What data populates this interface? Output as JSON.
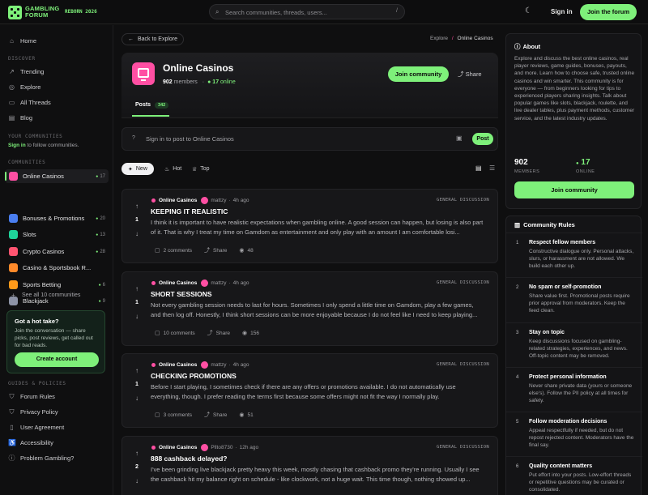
{
  "colors": {
    "accent": "#7ef07a",
    "pink": "#ff4fa3",
    "bg": "#0f0f10"
  },
  "topbar": {
    "logo_line1": "GAMBLING",
    "logo_line2": "FORUM",
    "logo_tag": "REBORN 2026",
    "search_placeholder": "Search communities, threads, users...",
    "search_shortcut": "/",
    "theme_icon": "moon-icon",
    "signin": "Sign in",
    "join": "Join the forum"
  },
  "sidebar": {
    "main": [
      {
        "label": "Home",
        "icon": "home-icon"
      }
    ],
    "discover_label": "DISCOVER",
    "discover": [
      {
        "label": "Trending",
        "icon": "trending-icon"
      },
      {
        "label": "Explore",
        "icon": "compass-icon"
      },
      {
        "label": "All Threads",
        "icon": "threads-icon"
      },
      {
        "label": "Blog",
        "icon": "book-icon"
      }
    ],
    "your_label": "YOUR COMMUNITIES",
    "your_signin": "Sign in",
    "your_text": " to follow communities.",
    "communities_label": "COMMUNITIES",
    "communities": [
      {
        "label": "Online Casinos",
        "count": "17",
        "color": "#ff4fa3"
      },
      {
        "label": "Bonuses & Promotions",
        "count": "20",
        "color": "#4a7ef0"
      },
      {
        "label": "Slots",
        "count": "13",
        "color": "#1fd39a"
      },
      {
        "label": "Crypto Casinos",
        "count": "28",
        "color": "#ff5470"
      },
      {
        "label": "Casino & Sportsbook R...",
        "count": "",
        "color": "#ff8a2a"
      },
      {
        "label": "Sports Betting",
        "count": "6",
        "color": "#ff9a1a"
      },
      {
        "label": "Blackjack",
        "count": "9",
        "color": "#8d93a6"
      }
    ],
    "see_all": "See all 10 communities",
    "hot_title": "Got a hot take?",
    "hot_text": "Join the conversation — share picks, post reviews, get called out for bad reads.",
    "hot_button": "Create account",
    "guides_label": "GUIDES & POLICIES",
    "guides": [
      {
        "label": "Forum Rules",
        "icon": "shield-icon"
      },
      {
        "label": "Privacy Policy",
        "icon": "shield-icon"
      },
      {
        "label": "User Agreement",
        "icon": "document-icon"
      },
      {
        "label": "Accessibility",
        "icon": "accessibility-icon"
      },
      {
        "label": "Problem Gambling?",
        "icon": "help-icon"
      }
    ]
  },
  "main": {
    "back": "Back to Explore",
    "breadcrumb": {
      "root": "Explore",
      "sep": "/",
      "current": "Online Casinos"
    },
    "community": {
      "name": "Online Casinos",
      "members_num": "902",
      "members_label": " members",
      "online_num": "17",
      "online_label": " online",
      "join": "Join community",
      "share": "Share",
      "tab_label": "Posts",
      "tab_count": "342"
    },
    "composer": {
      "placeholder": "Sign in to post to Online Casinos",
      "button": "Post",
      "q": "?"
    },
    "sort": {
      "new": "New",
      "hot": "Hot",
      "top": "Top"
    },
    "posts": [
      {
        "community": "Online Casinos",
        "author": "mattzy",
        "time": "4h ago",
        "tag": "GENERAL DISCUSSION",
        "votes": "1",
        "title": "KEEPING IT REALISTIC",
        "body": "I think it is important to have realistic expectations when gambling online. A good session can happen, but losing is also part of it. That is why I treat my time on Gamdom as entertainment and only play with an amount I am comfortable losi...",
        "comments": "2 comments",
        "share": "Share",
        "views": "48"
      },
      {
        "community": "Online Casinos",
        "author": "mattzy",
        "time": "4h ago",
        "tag": "GENERAL DISCUSSION",
        "votes": "1",
        "title": "SHORT SESSIONS",
        "body": "Not every gambling session needs to last for hours. Sometimes I only spend a little time on Gamdom, play a few games, and then log off. Honestly, I think short sessions can be more enjoyable because I do not feel like I need to keep playing...",
        "comments": "10 comments",
        "share": "Share",
        "views": "156"
      },
      {
        "community": "Online Casinos",
        "author": "mattzy",
        "time": "4h ago",
        "tag": "GENERAL DISCUSSION",
        "votes": "1",
        "title": "CHECKING PROMOTIONS",
        "body": "Before I start playing, I sometimes check if there are any offers or promotions available. I do not automatically use everything, though. I prefer reading the terms first because some offers might not fit the way I normally play.",
        "comments": "3 comments",
        "share": "Share",
        "views": "51"
      },
      {
        "community": "Online Casinos",
        "author": "Pllto8730",
        "time": "12h ago",
        "tag": "GENERAL DISCUSSION",
        "votes": "2",
        "title": "888 cashback delayed?",
        "body": "I've been grinding live blackjack pretty heavy this week, mostly chasing that cashback promo they're running. Usually I see the cashback hit my balance right on schedule - like clockwork, not a huge wait. This time though, nothing showed up...",
        "comments": "",
        "share": "",
        "views": ""
      }
    ]
  },
  "right": {
    "about_title": "About",
    "about_text": "Explore and discuss the best online casinos, real player reviews, game guides, bonuses, payouts, and more. Learn how to choose safe, trusted online casinos and win smarter. This community is for everyone — from beginners looking for tips to experienced players sharing insights. Talk about popular games like slots, blackjack, roulette, and live dealer tables, plus payment methods, customer service, and the latest industry updates.",
    "members_num": "902",
    "members_label": "MEMBERS",
    "online_num": "17",
    "online_label": "ONLINE",
    "join": "Join community",
    "rules_title": "Community Rules",
    "rules": [
      {
        "n": "1",
        "title": "Respect fellow members",
        "desc": "Constructive dialogue only. Personal attacks, slurs, or harassment are not allowed. We build each other up."
      },
      {
        "n": "2",
        "title": "No spam or self-promotion",
        "desc": "Share value first. Promotional posts require prior approval from moderators. Keep the feed clean."
      },
      {
        "n": "3",
        "title": "Stay on topic",
        "desc": "Keep discussions focused on gambling-related strategies, experiences, and news. Off-topic content may be removed."
      },
      {
        "n": "4",
        "title": "Protect personal information",
        "desc": "Never share private data (yours or someone else's). Follow the PII policy at all times for safety."
      },
      {
        "n": "5",
        "title": "Follow moderation decisions",
        "desc": "Appeal respectfully if needed, but do not repost rejected content. Moderators have the final say."
      },
      {
        "n": "6",
        "title": "Quality content matters",
        "desc": "Put effort into your posts. Low-effort threads or repetitive questions may be curated or consolidated."
      }
    ]
  }
}
